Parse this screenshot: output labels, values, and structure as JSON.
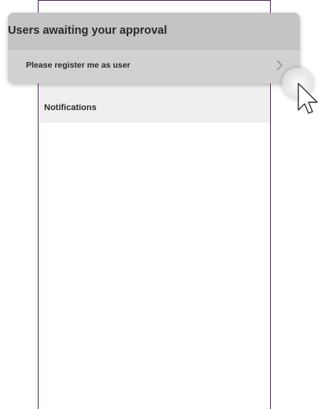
{
  "popup": {
    "title": "Users awaiting your approval",
    "items": [
      {
        "label": "Please register me as user",
        "icon": "chevron-right-icon"
      }
    ]
  },
  "background_app": {
    "section_title": "Notifications"
  },
  "colors": {
    "frame_border": "#4b2f57",
    "popup_bg": "#c8c8c8",
    "section_bg": "#efefef"
  },
  "cursor": {
    "icon": "pointer-cursor-icon"
  }
}
